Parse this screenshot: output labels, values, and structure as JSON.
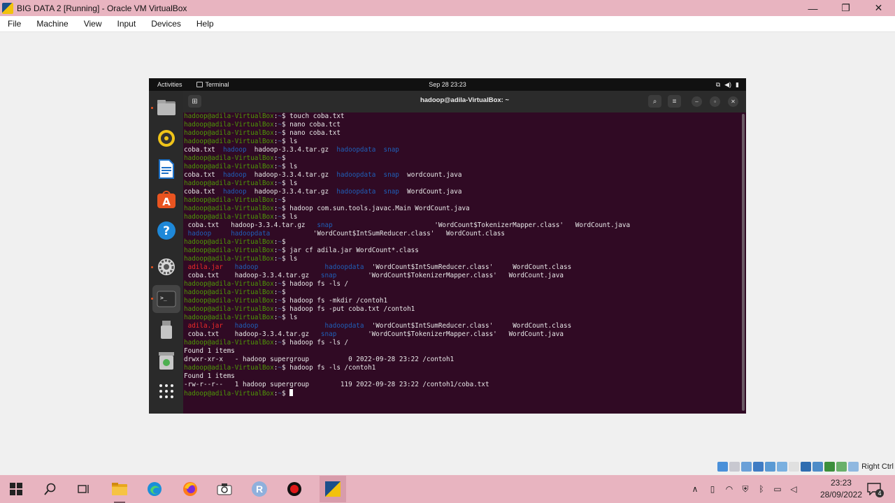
{
  "host_window": {
    "title": "BIG DATA 2 [Running] - Oracle VM VirtualBox",
    "controls": [
      "—",
      "❐",
      "✕"
    ],
    "menu": [
      "File",
      "Machine",
      "View",
      "Input",
      "Devices",
      "Help"
    ]
  },
  "guest_topbar": {
    "activities": "Activities",
    "app_name": "Terminal",
    "clock": "Sep 28  23:23"
  },
  "terminal": {
    "title": "hadoop@adila-VirtualBox: ~",
    "prompt_user": "hadoop@adila-VirtualBox",
    "prompt_path": "~",
    "lines": [
      [
        {
          "t": "hadoop@adila-VirtualBox",
          "c": "prompt"
        },
        {
          "t": ":",
          "c": "text"
        },
        {
          "t": "~",
          "c": "path"
        },
        {
          "t": "$ touch coba.txt",
          "c": "text"
        }
      ],
      [
        {
          "t": "hadoop@adila-VirtualBox",
          "c": "prompt"
        },
        {
          "t": ":",
          "c": "text"
        },
        {
          "t": "~",
          "c": "path"
        },
        {
          "t": "$ nano coba.tct",
          "c": "text"
        }
      ],
      [
        {
          "t": "hadoop@adila-VirtualBox",
          "c": "prompt"
        },
        {
          "t": ":",
          "c": "text"
        },
        {
          "t": "~",
          "c": "path"
        },
        {
          "t": "$ nano coba.txt",
          "c": "text"
        }
      ],
      [
        {
          "t": "hadoop@adila-VirtualBox",
          "c": "prompt"
        },
        {
          "t": ":",
          "c": "text"
        },
        {
          "t": "~",
          "c": "path"
        },
        {
          "t": "$ ls",
          "c": "text"
        }
      ],
      [
        {
          "t": "coba.txt  ",
          "c": "text"
        },
        {
          "t": "hadoop",
          "c": "dir"
        },
        {
          "t": "  hadoop-3.3.4.tar.gz  ",
          "c": "text"
        },
        {
          "t": "hadoopdata",
          "c": "dir"
        },
        {
          "t": "  ",
          "c": "text"
        },
        {
          "t": "snap",
          "c": "dir"
        }
      ],
      [
        {
          "t": "hadoop@adila-VirtualBox",
          "c": "prompt"
        },
        {
          "t": ":",
          "c": "text"
        },
        {
          "t": "~",
          "c": "path"
        },
        {
          "t": "$",
          "c": "text"
        }
      ],
      [
        {
          "t": "hadoop@adila-VirtualBox",
          "c": "prompt"
        },
        {
          "t": ":",
          "c": "text"
        },
        {
          "t": "~",
          "c": "path"
        },
        {
          "t": "$ ls",
          "c": "text"
        }
      ],
      [
        {
          "t": "coba.txt  ",
          "c": "text"
        },
        {
          "t": "hadoop",
          "c": "dir"
        },
        {
          "t": "  hadoop-3.3.4.tar.gz  ",
          "c": "text"
        },
        {
          "t": "hadoopdata",
          "c": "dir"
        },
        {
          "t": "  ",
          "c": "text"
        },
        {
          "t": "snap",
          "c": "dir"
        },
        {
          "t": "  wordcount.java",
          "c": "text"
        }
      ],
      [
        {
          "t": "hadoop@adila-VirtualBox",
          "c": "prompt"
        },
        {
          "t": ":",
          "c": "text"
        },
        {
          "t": "~",
          "c": "path"
        },
        {
          "t": "$ ls",
          "c": "text"
        }
      ],
      [
        {
          "t": "coba.txt  ",
          "c": "text"
        },
        {
          "t": "hadoop",
          "c": "dir"
        },
        {
          "t": "  hadoop-3.3.4.tar.gz  ",
          "c": "text"
        },
        {
          "t": "hadoopdata",
          "c": "dir"
        },
        {
          "t": "  ",
          "c": "text"
        },
        {
          "t": "snap",
          "c": "dir"
        },
        {
          "t": "  WordCount.java",
          "c": "text"
        }
      ],
      [
        {
          "t": "hadoop@adila-VirtualBox",
          "c": "prompt"
        },
        {
          "t": ":",
          "c": "text"
        },
        {
          "t": "~",
          "c": "path"
        },
        {
          "t": "$",
          "c": "text"
        }
      ],
      [
        {
          "t": "hadoop@adila-VirtualBox",
          "c": "prompt"
        },
        {
          "t": ":",
          "c": "text"
        },
        {
          "t": "~",
          "c": "path"
        },
        {
          "t": "$ hadoop com.sun.tools.javac.Main WordCount.java",
          "c": "text"
        }
      ],
      [
        {
          "t": "hadoop@adila-VirtualBox",
          "c": "prompt"
        },
        {
          "t": ":",
          "c": "text"
        },
        {
          "t": "~",
          "c": "path"
        },
        {
          "t": "$ ls",
          "c": "text"
        }
      ],
      [
        {
          "t": " coba.txt   hadoop-3.3.4.tar.gz   ",
          "c": "text"
        },
        {
          "t": "snap",
          "c": "dir"
        },
        {
          "t": "                          'WordCount$TokenizerMapper.class'   WordCount.java",
          "c": "text"
        }
      ],
      [
        {
          "t": " ",
          "c": "text"
        },
        {
          "t": "hadoop",
          "c": "dir"
        },
        {
          "t": "     ",
          "c": "text"
        },
        {
          "t": "hadoopdata",
          "c": "dir"
        },
        {
          "t": "           'WordCount$IntSumReducer.class'   WordCount.class",
          "c": "text"
        }
      ],
      [
        {
          "t": "hadoop@adila-VirtualBox",
          "c": "prompt"
        },
        {
          "t": ":",
          "c": "text"
        },
        {
          "t": "~",
          "c": "path"
        },
        {
          "t": "$",
          "c": "text"
        }
      ],
      [
        {
          "t": "hadoop@adila-VirtualBox",
          "c": "prompt"
        },
        {
          "t": ":",
          "c": "text"
        },
        {
          "t": "~",
          "c": "path"
        },
        {
          "t": "$ jar cf adila.jar WordCount*.class",
          "c": "text"
        }
      ],
      [
        {
          "t": "hadoop@adila-VirtualBox",
          "c": "prompt"
        },
        {
          "t": ":",
          "c": "text"
        },
        {
          "t": "~",
          "c": "path"
        },
        {
          "t": "$ ls",
          "c": "text"
        }
      ],
      [
        {
          "t": " ",
          "c": "text"
        },
        {
          "t": "adila.jar",
          "c": "red"
        },
        {
          "t": "   ",
          "c": "text"
        },
        {
          "t": "hadoop",
          "c": "dir"
        },
        {
          "t": "                 ",
          "c": "text"
        },
        {
          "t": "hadoopdata",
          "c": "dir"
        },
        {
          "t": "  'WordCount$IntSumReducer.class'     WordCount.class",
          "c": "text"
        }
      ],
      [
        {
          "t": " coba.txt    hadoop-3.3.4.tar.gz   ",
          "c": "text"
        },
        {
          "t": "snap",
          "c": "dir"
        },
        {
          "t": "        'WordCount$TokenizerMapper.class'   WordCount.java",
          "c": "text"
        }
      ],
      [
        {
          "t": "hadoop@adila-VirtualBox",
          "c": "prompt"
        },
        {
          "t": ":",
          "c": "text"
        },
        {
          "t": "~",
          "c": "path"
        },
        {
          "t": "$ hadoop fs -ls /",
          "c": "text"
        }
      ],
      [
        {
          "t": "hadoop@adila-VirtualBox",
          "c": "prompt"
        },
        {
          "t": ":",
          "c": "text"
        },
        {
          "t": "~",
          "c": "path"
        },
        {
          "t": "$",
          "c": "text"
        }
      ],
      [
        {
          "t": "hadoop@adila-VirtualBox",
          "c": "prompt"
        },
        {
          "t": ":",
          "c": "text"
        },
        {
          "t": "~",
          "c": "path"
        },
        {
          "t": "$ hadoop fs -mkdir /contoh1",
          "c": "text"
        }
      ],
      [
        {
          "t": "hadoop@adila-VirtualBox",
          "c": "prompt"
        },
        {
          "t": ":",
          "c": "text"
        },
        {
          "t": "~",
          "c": "path"
        },
        {
          "t": "$ hadoop fs -put coba.txt /contoh1",
          "c": "text"
        }
      ],
      [
        {
          "t": "hadoop@adila-VirtualBox",
          "c": "prompt"
        },
        {
          "t": ":",
          "c": "text"
        },
        {
          "t": "~",
          "c": "path"
        },
        {
          "t": "$ ls",
          "c": "text"
        }
      ],
      [
        {
          "t": " ",
          "c": "text"
        },
        {
          "t": "adila.jar",
          "c": "red"
        },
        {
          "t": "   ",
          "c": "text"
        },
        {
          "t": "hadoop",
          "c": "dir"
        },
        {
          "t": "                 ",
          "c": "text"
        },
        {
          "t": "hadoopdata",
          "c": "dir"
        },
        {
          "t": "  'WordCount$IntSumReducer.class'     WordCount.class",
          "c": "text"
        }
      ],
      [
        {
          "t": " coba.txt    hadoop-3.3.4.tar.gz   ",
          "c": "text"
        },
        {
          "t": "snap",
          "c": "dir"
        },
        {
          "t": "        'WordCount$TokenizerMapper.class'   WordCount.java",
          "c": "text"
        }
      ],
      [
        {
          "t": "hadoop@adila-VirtualBox",
          "c": "prompt"
        },
        {
          "t": ":",
          "c": "text"
        },
        {
          "t": "~",
          "c": "path"
        },
        {
          "t": "$ hadoop fs -ls /",
          "c": "text"
        }
      ],
      [
        {
          "t": "Found 1 items",
          "c": "text"
        }
      ],
      [
        {
          "t": "drwxr-xr-x   - hadoop supergroup          0 2022-09-28 23:22 /contoh1",
          "c": "text"
        }
      ],
      [
        {
          "t": "hadoop@adila-VirtualBox",
          "c": "prompt"
        },
        {
          "t": ":",
          "c": "text"
        },
        {
          "t": "~",
          "c": "path"
        },
        {
          "t": "$ hadoop fs -ls /contoh1",
          "c": "text"
        }
      ],
      [
        {
          "t": "Found 1 items",
          "c": "text"
        }
      ],
      [
        {
          "t": "-rw-r--r--   1 hadoop supergroup        119 2022-09-28 23:22 /contoh1/coba.txt",
          "c": "text"
        }
      ],
      [
        {
          "t": "hadoop@adila-VirtualBox",
          "c": "prompt"
        },
        {
          "t": ":",
          "c": "text"
        },
        {
          "t": "~",
          "c": "path"
        },
        {
          "t": "$ ",
          "c": "text"
        },
        {
          "t": "",
          "c": "cursor"
        }
      ]
    ]
  },
  "vbox_status": {
    "host_key": "Right Ctrl"
  },
  "taskbar": {
    "time": "23:23",
    "date": "28/09/2022",
    "notification_count": "4",
    "r_app_letter": "R"
  },
  "colors": {
    "terminal_bg": "#300a24",
    "prompt_green": "#4e9a06",
    "dir_blue": "#1f5fb8",
    "archive_red": "#ef2929",
    "host_titlebar": "#e8b4c0"
  },
  "icons": {
    "dock": [
      "files-icon",
      "rhythmbox-icon",
      "libreoffice-writer-icon",
      "ubuntu-software-icon",
      "help-icon",
      "settings-icon",
      "terminal-icon",
      "usb-drive-icon",
      "trash-icon",
      "show-apps-icon"
    ],
    "taskbar": [
      "windows-start-icon",
      "search-icon",
      "task-view-icon",
      "file-explorer-icon",
      "edge-icon",
      "firefox-icon",
      "camera-icon",
      "r-app-icon",
      "record-icon",
      "virtualbox-icon"
    ]
  }
}
